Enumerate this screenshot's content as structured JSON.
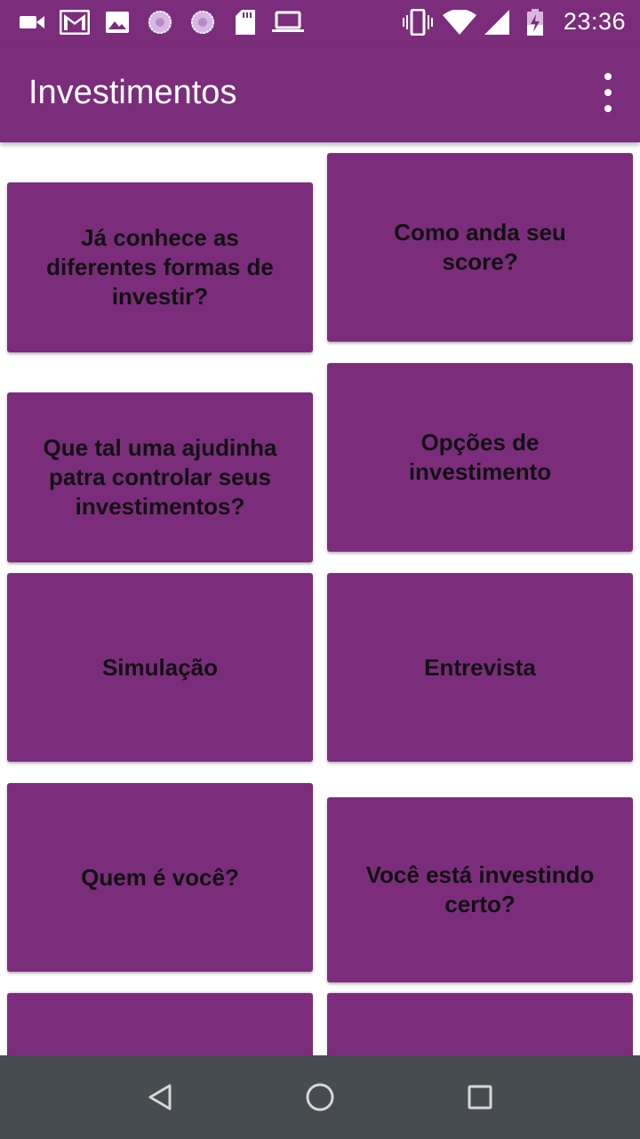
{
  "status_bar": {
    "time": "23:36",
    "icons_left": [
      "video-camera-icon",
      "gmail-icon",
      "image-icon",
      "sync-icon",
      "sync-icon",
      "sd-card-icon",
      "laptop-icon"
    ],
    "icons_right": [
      "vibrate-icon",
      "wifi-icon",
      "signal-icon",
      "battery-charging-icon"
    ]
  },
  "app_bar": {
    "title": "Investimentos",
    "menu_icon": "more-vert-icon"
  },
  "cards": [
    {
      "label": "Já conhece as diferentes formas de investir?"
    },
    {
      "label": "Como anda seu score?"
    },
    {
      "label": "Que tal uma ajudinha patra controlar seus investimentos?"
    },
    {
      "label": "Opções de investimento"
    },
    {
      "label": "Simulação"
    },
    {
      "label": "Entrevista"
    },
    {
      "label": "Quem é você?"
    },
    {
      "label": "Você está investindo certo?"
    },
    {
      "label": ""
    },
    {
      "label": ""
    }
  ],
  "nav_bar": {
    "icons": [
      "back-icon",
      "home-icon",
      "recents-icon"
    ]
  },
  "colors": {
    "primary": "#7b2d7b",
    "card_text": "#111111",
    "nav_bar": "#464c50",
    "background": "#ffffff"
  }
}
